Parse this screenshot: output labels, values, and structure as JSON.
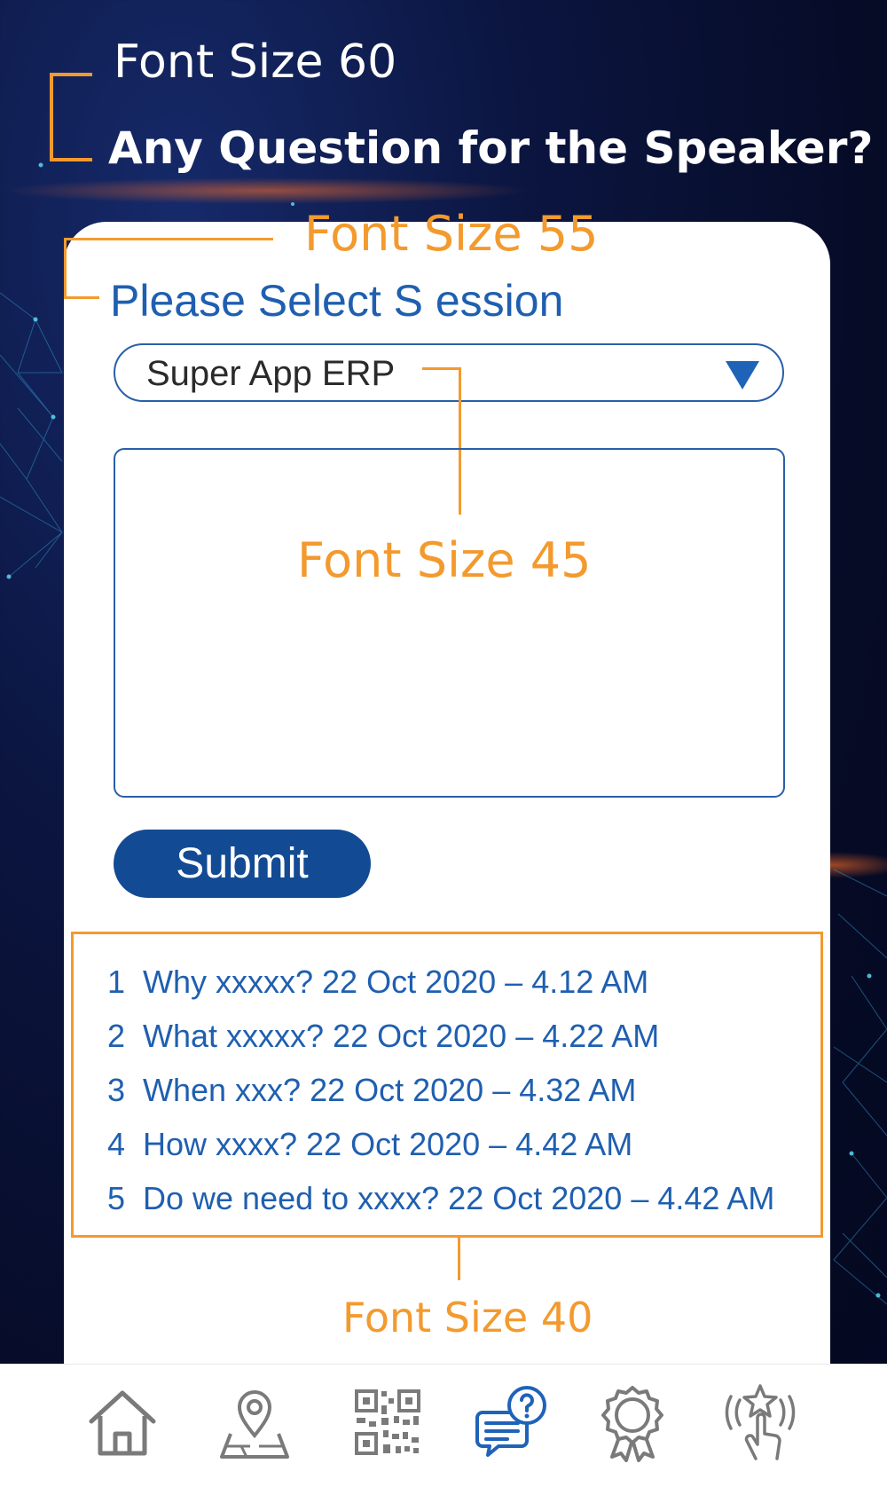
{
  "annotations": {
    "heading_font_note": "Font Size 60",
    "label_font_note": "Font Size 55",
    "input_font_note": "Font Size 45",
    "list_font_note": "Font Size 40"
  },
  "page": {
    "title": "Any Question for the Speaker?"
  },
  "form": {
    "session_label": "Please Select S ession",
    "session_select_value": "Super App ERP",
    "question_input_value": "",
    "submit_label": "Submit"
  },
  "questions": [
    {
      "num": "1",
      "text": "Why xxxxx?  22 Oct 2020 – 4.12 AM"
    },
    {
      "num": "2",
      "text": "What xxxxx? 22 Oct 2020 – 4.22 AM"
    },
    {
      "num": "3",
      "text": "When xxx? 22 Oct 2020 – 4.32 AM"
    },
    {
      "num": "4",
      "text": "How xxxx? 22 Oct 2020 – 4.42 AM"
    },
    {
      "num": "5",
      "text": "Do we need to xxxx? 22 Oct 2020 – 4.42 AM"
    }
  ],
  "tabbar": {
    "items": [
      {
        "icon": "home-icon"
      },
      {
        "icon": "map-location-icon"
      },
      {
        "icon": "qr-code-icon"
      },
      {
        "icon": "question-chat-icon",
        "active": true
      },
      {
        "icon": "award-badge-icon"
      },
      {
        "icon": "rate-tap-icon"
      }
    ]
  },
  "colors": {
    "accent_orange": "#f39a2e",
    "primary_blue": "#124b93",
    "text_blue": "#1f5fb0",
    "icon_gray": "#7a7a7a",
    "active_icon_blue": "#1f63b8"
  }
}
